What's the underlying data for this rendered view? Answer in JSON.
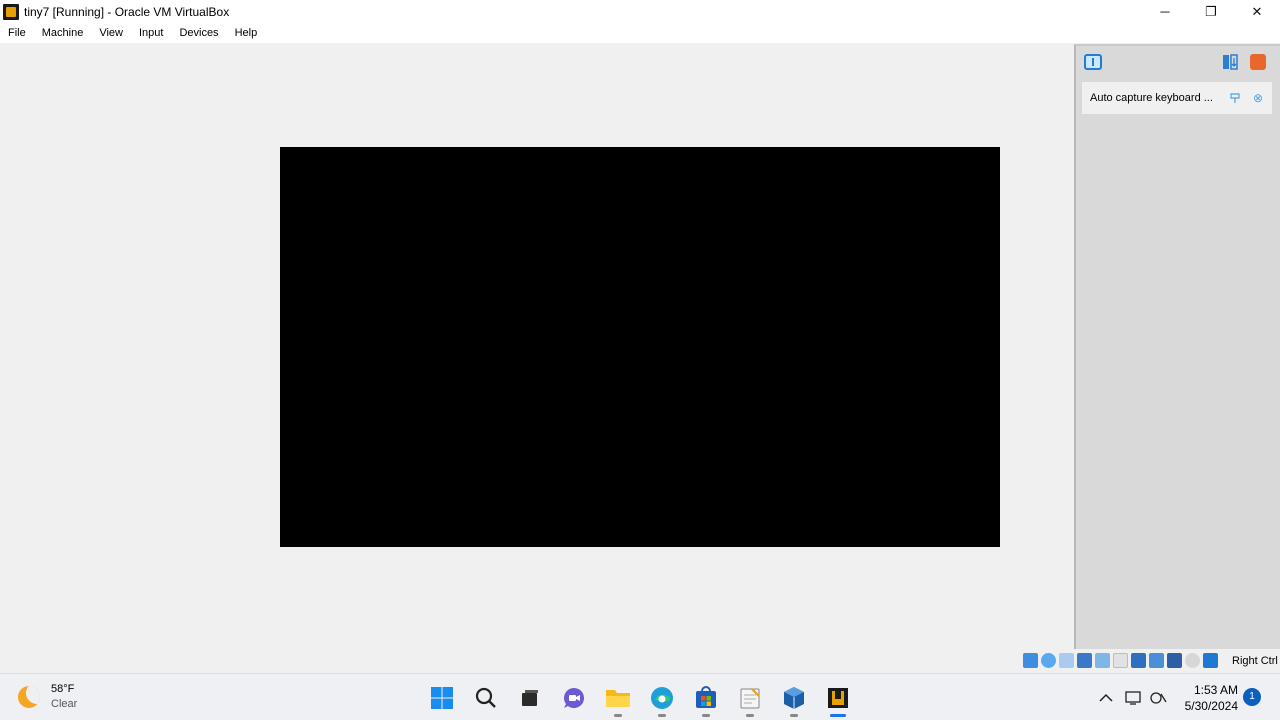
{
  "window": {
    "title": "tiny7 [Running] - Oracle VM VirtualBox",
    "minimize_label": "─",
    "maximize_label": "❐",
    "close_label": "✕"
  },
  "menu": {
    "items": [
      {
        "label": "File"
      },
      {
        "label": "Machine"
      },
      {
        "label": "View"
      },
      {
        "label": "Input"
      },
      {
        "label": "Devices"
      },
      {
        "label": "Help"
      }
    ]
  },
  "notification_panel": {
    "message": "Auto capture keyboard ..."
  },
  "statusbar": {
    "icons": [
      "hard-disk-icon",
      "optical-drive-icon",
      "audio-icon",
      "network-icon",
      "usb-icon",
      "shared-folder-icon",
      "display-icon",
      "recording-icon",
      "cpu-icon",
      "mouse-integration-icon",
      "keyboard-capture-icon"
    ],
    "host_key": "Right Ctrl"
  },
  "taskbar": {
    "weather": {
      "temp": "58°F",
      "condition": "Clear"
    },
    "apps": [
      "start-icon",
      "search-icon",
      "task-view-icon",
      "teams-chat-icon",
      "file-explorer-icon",
      "edge-icon",
      "store-icon",
      "notepad-icon",
      "virtualbox-icon",
      "virtualbox-vm-icon"
    ],
    "clock": {
      "time": "1:53 AM",
      "date": "5/30/2024"
    },
    "notification_count": "1"
  }
}
